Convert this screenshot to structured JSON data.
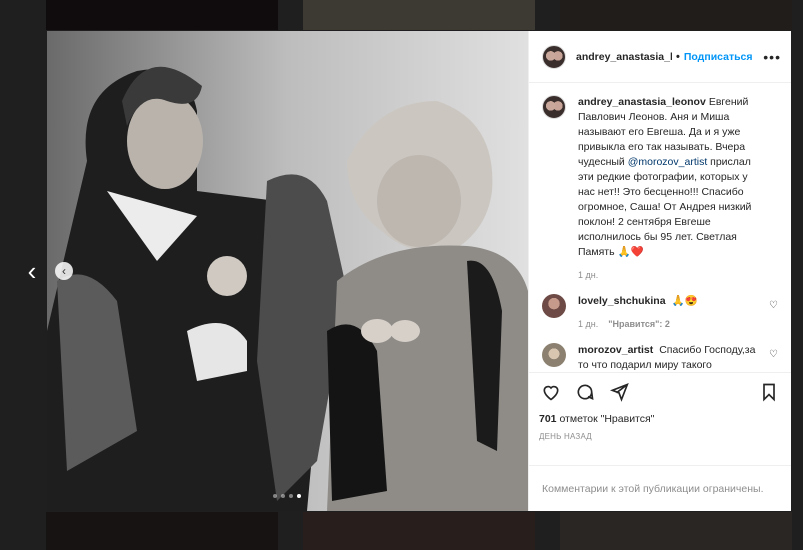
{
  "post": {
    "username": "andrey_anastasia_leonov",
    "header_username": "andrey_anastasia_le",
    "separator": "•",
    "follow_label": "Подписаться",
    "more_label": "•••",
    "caption_text": "Евгений Павлович Леонов. Аня и Миша называют его Евгеша. Да и я уже привыкла его так называть. Вчера чудесный ",
    "caption_mention": "@morozov_artist",
    "caption_text_2": " прислал эти редкие фотографии, которых у нас нет!! Это бесценно!!! Спасибо огромное, Саша! От Андрея низкий поклон! 2 сентября Евгеше исполнилось бы 95 лет. Светлая Память 🙏❤️",
    "caption_time": "1 дн.",
    "likes_count": "701",
    "likes_label": "отметок \"Нравится\"",
    "time_ago": "ДЕНЬ НАЗАД",
    "comments_disabled": "Комментарии к этой публикации ограничены."
  },
  "comments": [
    {
      "username": "lovely_shchukina",
      "text": "🙏😍",
      "time": "1 дн.",
      "likes": "\"Нравится\": 2"
    },
    {
      "username": "morozov_artist",
      "text": "Спасибо Господу,за то что подарил миру такого Человека и",
      "time": "",
      "likes": ""
    }
  ],
  "carousel": {
    "current": 4,
    "total": 4
  },
  "icons": [
    "heart-icon",
    "comment-icon",
    "share-icon",
    "bookmark-icon",
    "chevron-left-icon"
  ],
  "colors": {
    "accent": "#0095f6",
    "mention": "#00376b",
    "muted": "#8e8e8e"
  }
}
